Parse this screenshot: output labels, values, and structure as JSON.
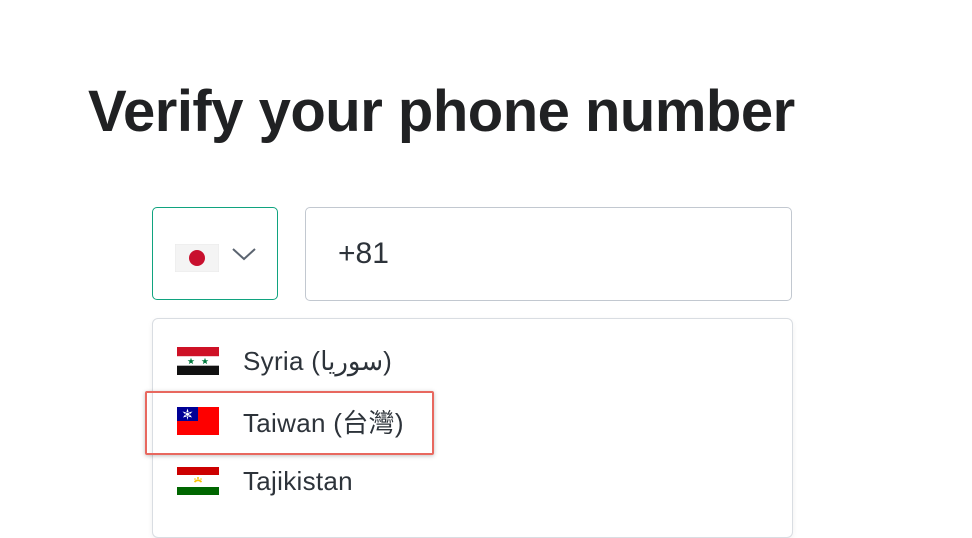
{
  "page": {
    "title": "Verify your phone number"
  },
  "country_select": {
    "selected_flag": "japan-flag-icon",
    "chevron_icon": "chevron-down-icon"
  },
  "phone_input": {
    "value": "+81"
  },
  "dropdown": {
    "options": [
      {
        "label": "Syria (سوريا)",
        "flag": "syria-flag-icon"
      },
      {
        "label": "Taiwan (台灣)",
        "flag": "taiwan-flag-icon",
        "highlighted": true
      },
      {
        "label": "Tajikistan",
        "flag": "tajikistan-flag-icon"
      }
    ]
  },
  "colors": {
    "accent": "#10a37f",
    "highlight": "#e8685f",
    "text": "#202123"
  }
}
